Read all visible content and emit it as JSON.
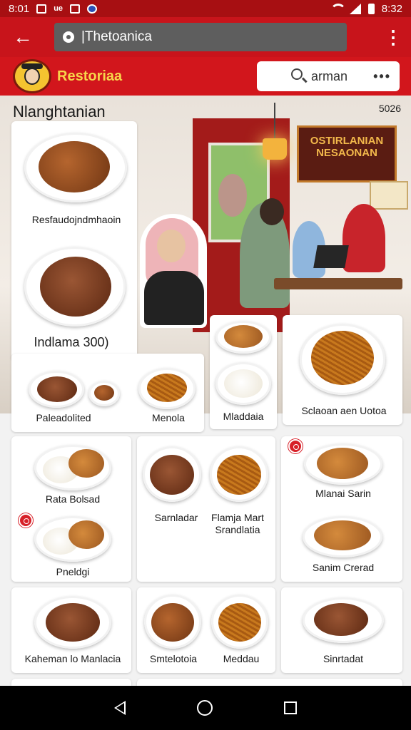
{
  "status_bar": {
    "time_left": "8:01",
    "mini_label": "ue",
    "time_right": "8:32"
  },
  "app_bar": {
    "url": "|Thetoanica"
  },
  "brand": {
    "name": "Restoriaa",
    "search_text": "arman",
    "more": "•••"
  },
  "hero": {
    "title": "Nlanghtanian",
    "number": "5026",
    "sign_text": "OSTIRLANIAN NESAONAN"
  },
  "cards": {
    "feature": {
      "label1": "Resfaudojndmhaoin",
      "label2": "Indlama 300)",
      "label3": "Paleadolited",
      "label4": "Menola"
    },
    "mladdaia": {
      "label": "Mladdaia"
    },
    "sclaoan": {
      "label": "Sclaoan aen Uotoa"
    },
    "row1_a": {
      "label1": "Rata Bolsad",
      "label2": "Pneldgi"
    },
    "row1_b": {
      "label1": "Sarnladar",
      "label2": "Flamja Mart Srandlatia"
    },
    "row1_c": {
      "label1": "Mlanai Sarin",
      "label2": "Sanim Crerad"
    },
    "row2_a": {
      "label": "Kaheman lo Manlacia"
    },
    "row2_b": {
      "label1": "Smtelotoia",
      "label2": "Meddau"
    },
    "row2_c": {
      "label": "Sinrtadat"
    }
  },
  "colors": {
    "primary_red": "#c8141b",
    "brand_yellow": "#f7d54a"
  }
}
